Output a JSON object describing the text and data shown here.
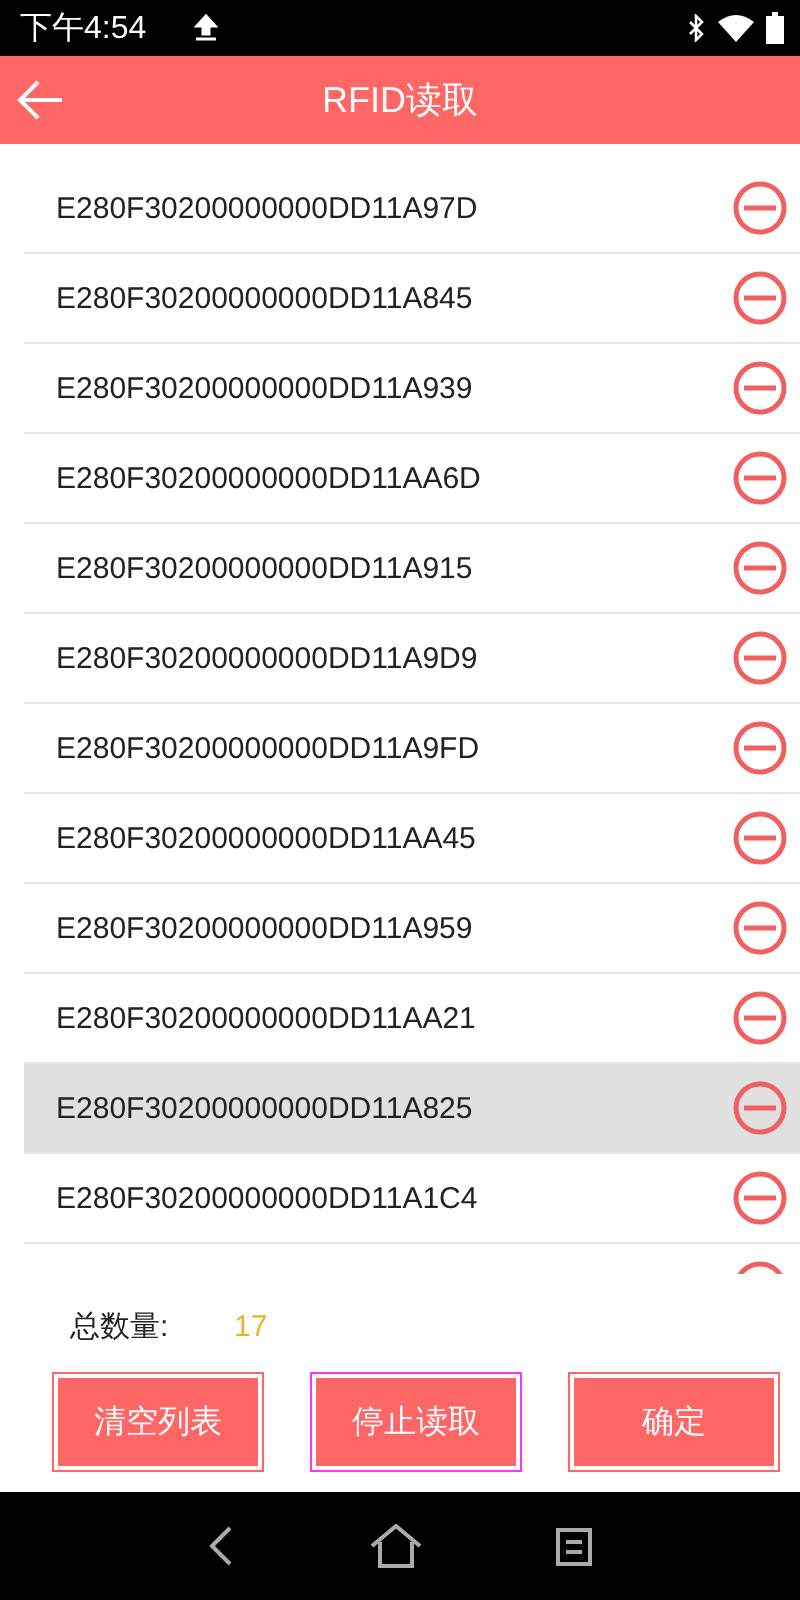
{
  "status_bar": {
    "time": "下午4:54"
  },
  "header": {
    "title": "RFID读取"
  },
  "tags": [
    {
      "epc": "E280F30200000000DD11A97D",
      "selected": false
    },
    {
      "epc": "E280F30200000000DD11A845",
      "selected": false
    },
    {
      "epc": "E280F30200000000DD11A939",
      "selected": false
    },
    {
      "epc": "E280F30200000000DD11AA6D",
      "selected": false
    },
    {
      "epc": "E280F30200000000DD11A915",
      "selected": false
    },
    {
      "epc": "E280F30200000000DD11A9D9",
      "selected": false
    },
    {
      "epc": "E280F30200000000DD11A9FD",
      "selected": false
    },
    {
      "epc": "E280F30200000000DD11AA45",
      "selected": false
    },
    {
      "epc": "E280F30200000000DD11A959",
      "selected": false
    },
    {
      "epc": "E280F30200000000DD11AA21",
      "selected": false
    },
    {
      "epc": "E280F30200000000DD11A825",
      "selected": true
    },
    {
      "epc": "E280F30200000000DD11A1C4",
      "selected": false
    }
  ],
  "total": {
    "label": "总数量:",
    "value": "17"
  },
  "buttons": [
    {
      "label": "清空列表",
      "focused": false
    },
    {
      "label": "停止读取",
      "focused": true
    },
    {
      "label": "确定",
      "focused": false
    }
  ]
}
